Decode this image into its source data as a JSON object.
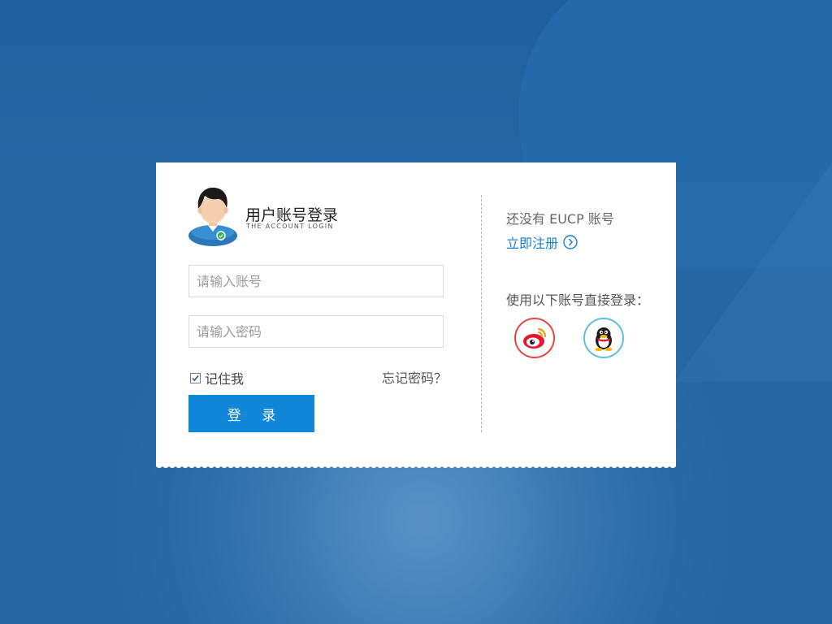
{
  "header": {
    "title": "用户账号登录",
    "subtitle": "THE ACCOUNT LOGIN"
  },
  "form": {
    "account_placeholder": "请输入账号",
    "password_placeholder": "请输入密码",
    "remember_label": "记住我",
    "remember_checked": true,
    "forgot_label": "忘记密码？",
    "login_label": "登 录"
  },
  "side": {
    "no_account_text": "还没有 EUCP 账号",
    "register_label": "立即注册",
    "social_label": "使用以下账号直接登录：",
    "social_icons": [
      "weibo-icon",
      "qq-icon"
    ]
  },
  "colors": {
    "background": "#2466a4",
    "primary_button": "#0f86d8",
    "link": "#1a7fd0",
    "weibo_ring": "#e2483b",
    "qq_ring": "#5fbde3"
  }
}
